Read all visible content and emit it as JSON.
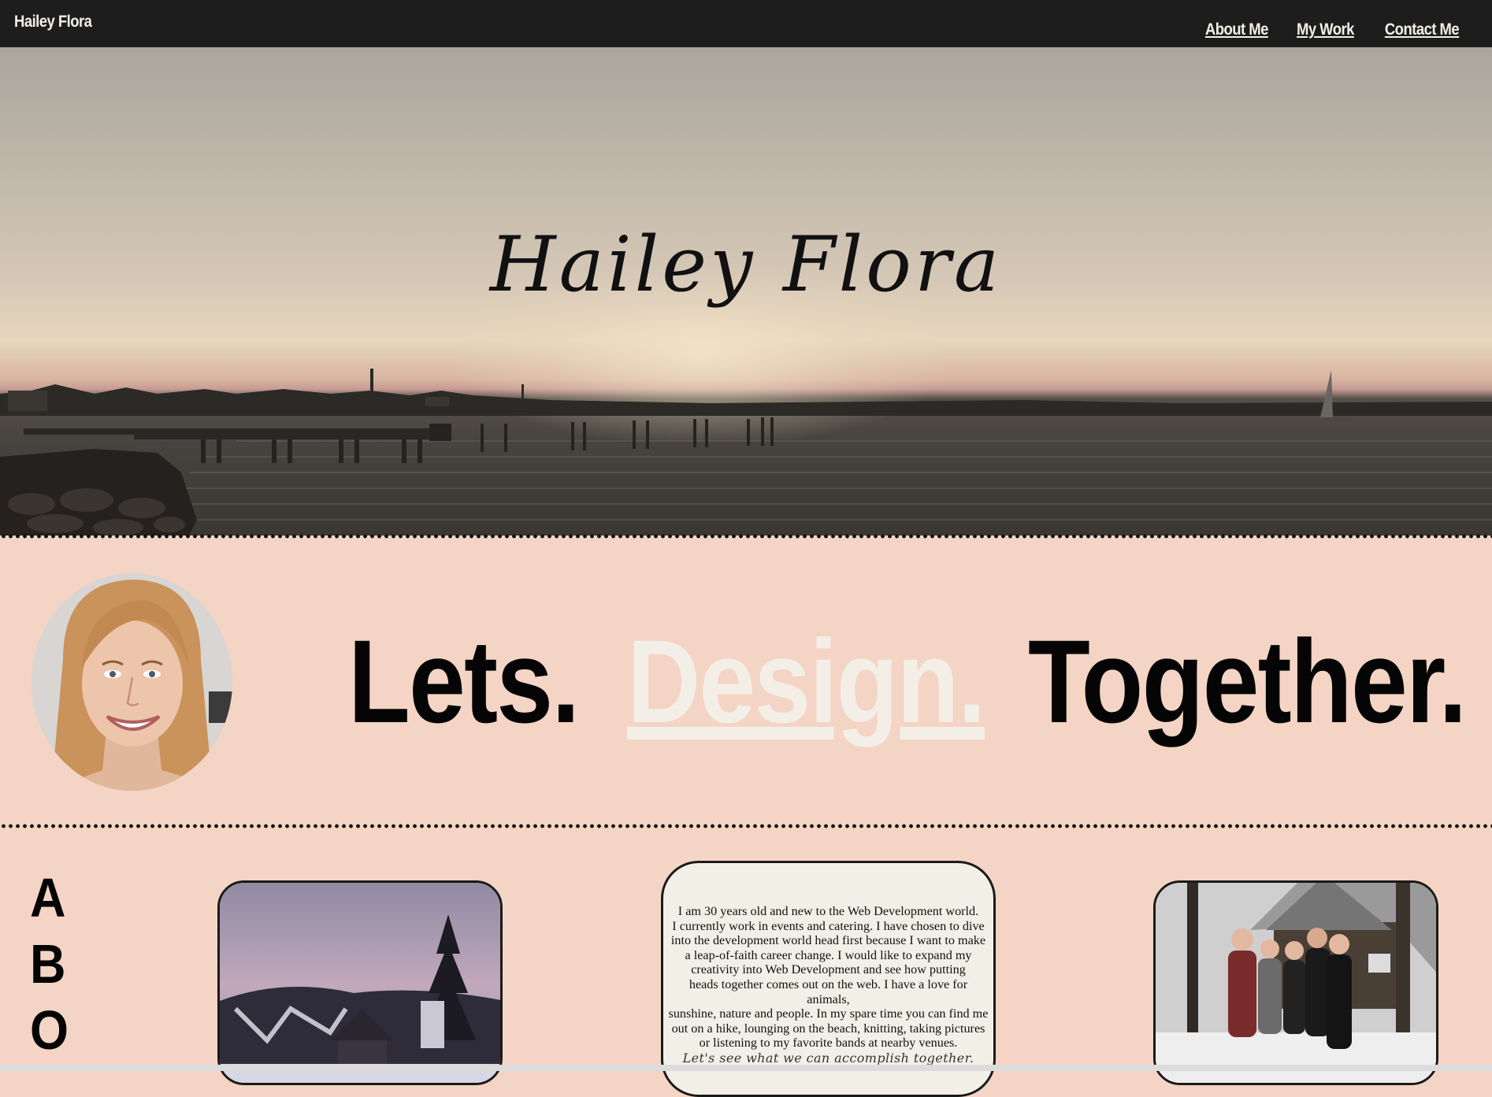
{
  "header": {
    "brand": "Hailey Flora",
    "nav": [
      {
        "label": "About Me"
      },
      {
        "label": "My Work"
      },
      {
        "label": "Contact Me"
      }
    ]
  },
  "hero": {
    "title": "Hailey Flora"
  },
  "tagline": {
    "words": [
      "Lets.",
      "Design.",
      "Together."
    ]
  },
  "about": {
    "vertical_letters": [
      "A",
      "B",
      "O"
    ],
    "bio": "I am 30 years old and new to the Web Development world.\nI currently work in events and catering. I have chosen to dive\ninto the development world head first because I want to make\na leap-of-faith career change. I would like to expand my\ncreativity into Web Development and see how putting\nheads together comes out on the web. I have a love for animals,\nsunshine, nature and people. In my spare time you can find me\nout on a hike, lounging on the beach, knitting, taking pictures\nor listening to my favorite bands at nearby venues.",
    "bio_tagline": "Let's see what we can accomplish together."
  },
  "colors": {
    "nav_bg": "#1d1d1d",
    "page_bg": "#f4d4c4",
    "card_bg": "#f2efe7",
    "accent_light": "#f3efe7"
  }
}
